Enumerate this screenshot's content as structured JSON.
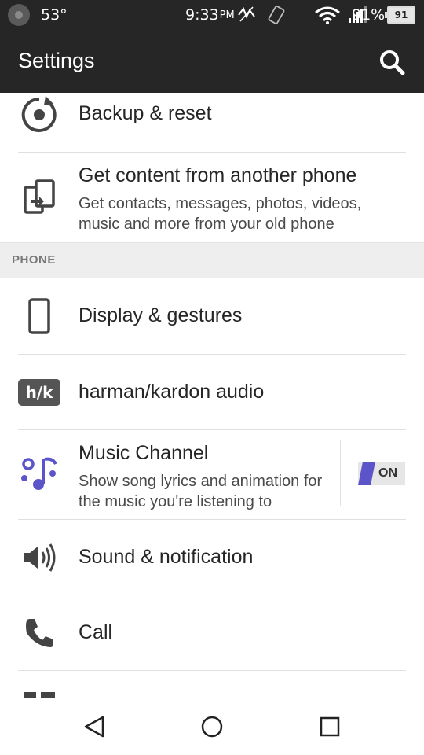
{
  "status_bar": {
    "temperature": "53°",
    "time": "9:33",
    "ampm": "PM",
    "battery_percent": "91%",
    "battery_level": "91"
  },
  "app_bar": {
    "title": "Settings",
    "search_icon": "search-icon"
  },
  "items": [
    {
      "icon": "backup-reset-icon",
      "title": "Backup & reset"
    },
    {
      "icon": "transfer-phone-icon",
      "title": "Get content from another phone",
      "subtitle": "Get contacts, messages, photos, videos, music and more from your old phone"
    },
    {
      "icon": "phone-outline-icon",
      "title": "Display & gestures"
    },
    {
      "icon": "harman-kardon-icon",
      "icon_text": "h/k",
      "title": "harman/kardon audio"
    },
    {
      "icon": "music-notes-icon",
      "title": "Music Channel",
      "subtitle": "Show song lyrics and animation for the music you're listening to",
      "toggle": "ON"
    },
    {
      "icon": "speaker-icon",
      "title": "Sound & notification"
    },
    {
      "icon": "call-icon",
      "title": "Call"
    }
  ],
  "section_phone": "PHONE",
  "colors": {
    "toolbar_bg": "#262626",
    "accent": "#5b55c9",
    "section_bg": "#eeeeee"
  },
  "nav": {
    "back": "back-icon",
    "home": "home-icon",
    "recents": "recents-icon"
  }
}
